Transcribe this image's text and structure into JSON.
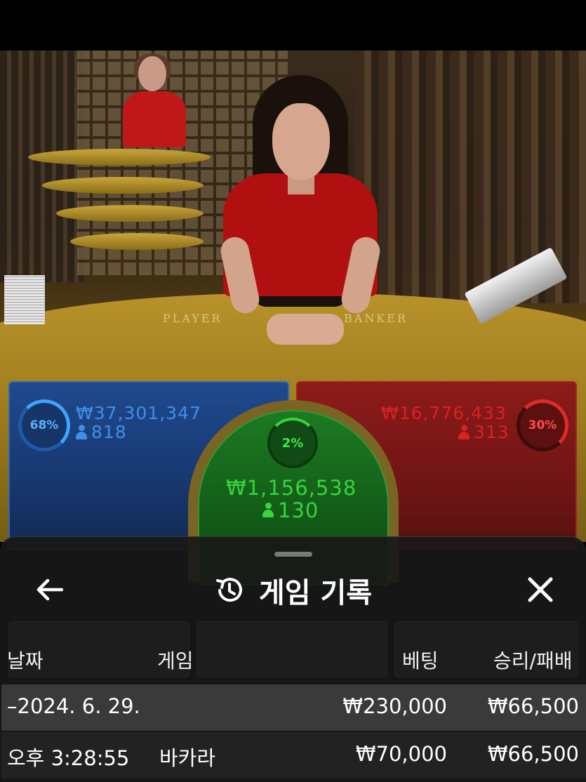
{
  "table": {
    "player_label": "PLAYER",
    "banker_label": "BANKER"
  },
  "bets": {
    "player": {
      "percent": "68%",
      "amount": "₩37,301,347",
      "players": "818",
      "color": "#3fa3ff"
    },
    "tie": {
      "percent": "2%",
      "amount": "₩1,156,538",
      "players": "130",
      "color": "#3fe84a"
    },
    "banker": {
      "percent": "30%",
      "amount": "₩16,776,433",
      "players": "313",
      "color": "#e02a2a"
    }
  },
  "sheet": {
    "title": "게임 기록",
    "back_icon": "arrow-left-icon",
    "history_icon": "history-icon",
    "close_icon": "close-icon",
    "columns": {
      "date": "날짜",
      "game": "게임",
      "bet": "베팅",
      "result": "승리/패배"
    },
    "rows": [
      {
        "date": "–2024. 6. 29.",
        "game": "",
        "bet": "₩230,000",
        "result": "₩66,500"
      },
      {
        "date": "오후 3:28:55",
        "game": "바카라",
        "bet": "₩70,000",
        "result": "₩66,500"
      }
    ]
  }
}
